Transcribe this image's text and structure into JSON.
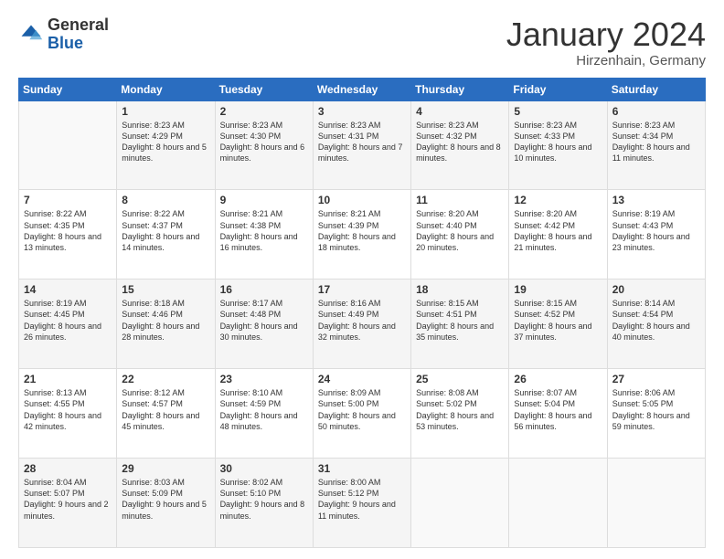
{
  "logo": {
    "general": "General",
    "blue": "Blue"
  },
  "title": "January 2024",
  "subtitle": "Hirzenhain, Germany",
  "days_of_week": [
    "Sunday",
    "Monday",
    "Tuesday",
    "Wednesday",
    "Thursday",
    "Friday",
    "Saturday"
  ],
  "weeks": [
    [
      {
        "day": "",
        "sunrise": "",
        "sunset": "",
        "daylight": ""
      },
      {
        "day": "1",
        "sunrise": "Sunrise: 8:23 AM",
        "sunset": "Sunset: 4:29 PM",
        "daylight": "Daylight: 8 hours and 5 minutes."
      },
      {
        "day": "2",
        "sunrise": "Sunrise: 8:23 AM",
        "sunset": "Sunset: 4:30 PM",
        "daylight": "Daylight: 8 hours and 6 minutes."
      },
      {
        "day": "3",
        "sunrise": "Sunrise: 8:23 AM",
        "sunset": "Sunset: 4:31 PM",
        "daylight": "Daylight: 8 hours and 7 minutes."
      },
      {
        "day": "4",
        "sunrise": "Sunrise: 8:23 AM",
        "sunset": "Sunset: 4:32 PM",
        "daylight": "Daylight: 8 hours and 8 minutes."
      },
      {
        "day": "5",
        "sunrise": "Sunrise: 8:23 AM",
        "sunset": "Sunset: 4:33 PM",
        "daylight": "Daylight: 8 hours and 10 minutes."
      },
      {
        "day": "6",
        "sunrise": "Sunrise: 8:23 AM",
        "sunset": "Sunset: 4:34 PM",
        "daylight": "Daylight: 8 hours and 11 minutes."
      }
    ],
    [
      {
        "day": "7",
        "sunrise": "Sunrise: 8:22 AM",
        "sunset": "Sunset: 4:35 PM",
        "daylight": "Daylight: 8 hours and 13 minutes."
      },
      {
        "day": "8",
        "sunrise": "Sunrise: 8:22 AM",
        "sunset": "Sunset: 4:37 PM",
        "daylight": "Daylight: 8 hours and 14 minutes."
      },
      {
        "day": "9",
        "sunrise": "Sunrise: 8:21 AM",
        "sunset": "Sunset: 4:38 PM",
        "daylight": "Daylight: 8 hours and 16 minutes."
      },
      {
        "day": "10",
        "sunrise": "Sunrise: 8:21 AM",
        "sunset": "Sunset: 4:39 PM",
        "daylight": "Daylight: 8 hours and 18 minutes."
      },
      {
        "day": "11",
        "sunrise": "Sunrise: 8:20 AM",
        "sunset": "Sunset: 4:40 PM",
        "daylight": "Daylight: 8 hours and 20 minutes."
      },
      {
        "day": "12",
        "sunrise": "Sunrise: 8:20 AM",
        "sunset": "Sunset: 4:42 PM",
        "daylight": "Daylight: 8 hours and 21 minutes."
      },
      {
        "day": "13",
        "sunrise": "Sunrise: 8:19 AM",
        "sunset": "Sunset: 4:43 PM",
        "daylight": "Daylight: 8 hours and 23 minutes."
      }
    ],
    [
      {
        "day": "14",
        "sunrise": "Sunrise: 8:19 AM",
        "sunset": "Sunset: 4:45 PM",
        "daylight": "Daylight: 8 hours and 26 minutes."
      },
      {
        "day": "15",
        "sunrise": "Sunrise: 8:18 AM",
        "sunset": "Sunset: 4:46 PM",
        "daylight": "Daylight: 8 hours and 28 minutes."
      },
      {
        "day": "16",
        "sunrise": "Sunrise: 8:17 AM",
        "sunset": "Sunset: 4:48 PM",
        "daylight": "Daylight: 8 hours and 30 minutes."
      },
      {
        "day": "17",
        "sunrise": "Sunrise: 8:16 AM",
        "sunset": "Sunset: 4:49 PM",
        "daylight": "Daylight: 8 hours and 32 minutes."
      },
      {
        "day": "18",
        "sunrise": "Sunrise: 8:15 AM",
        "sunset": "Sunset: 4:51 PM",
        "daylight": "Daylight: 8 hours and 35 minutes."
      },
      {
        "day": "19",
        "sunrise": "Sunrise: 8:15 AM",
        "sunset": "Sunset: 4:52 PM",
        "daylight": "Daylight: 8 hours and 37 minutes."
      },
      {
        "day": "20",
        "sunrise": "Sunrise: 8:14 AM",
        "sunset": "Sunset: 4:54 PM",
        "daylight": "Daylight: 8 hours and 40 minutes."
      }
    ],
    [
      {
        "day": "21",
        "sunrise": "Sunrise: 8:13 AM",
        "sunset": "Sunset: 4:55 PM",
        "daylight": "Daylight: 8 hours and 42 minutes."
      },
      {
        "day": "22",
        "sunrise": "Sunrise: 8:12 AM",
        "sunset": "Sunset: 4:57 PM",
        "daylight": "Daylight: 8 hours and 45 minutes."
      },
      {
        "day": "23",
        "sunrise": "Sunrise: 8:10 AM",
        "sunset": "Sunset: 4:59 PM",
        "daylight": "Daylight: 8 hours and 48 minutes."
      },
      {
        "day": "24",
        "sunrise": "Sunrise: 8:09 AM",
        "sunset": "Sunset: 5:00 PM",
        "daylight": "Daylight: 8 hours and 50 minutes."
      },
      {
        "day": "25",
        "sunrise": "Sunrise: 8:08 AM",
        "sunset": "Sunset: 5:02 PM",
        "daylight": "Daylight: 8 hours and 53 minutes."
      },
      {
        "day": "26",
        "sunrise": "Sunrise: 8:07 AM",
        "sunset": "Sunset: 5:04 PM",
        "daylight": "Daylight: 8 hours and 56 minutes."
      },
      {
        "day": "27",
        "sunrise": "Sunrise: 8:06 AM",
        "sunset": "Sunset: 5:05 PM",
        "daylight": "Daylight: 8 hours and 59 minutes."
      }
    ],
    [
      {
        "day": "28",
        "sunrise": "Sunrise: 8:04 AM",
        "sunset": "Sunset: 5:07 PM",
        "daylight": "Daylight: 9 hours and 2 minutes."
      },
      {
        "day": "29",
        "sunrise": "Sunrise: 8:03 AM",
        "sunset": "Sunset: 5:09 PM",
        "daylight": "Daylight: 9 hours and 5 minutes."
      },
      {
        "day": "30",
        "sunrise": "Sunrise: 8:02 AM",
        "sunset": "Sunset: 5:10 PM",
        "daylight": "Daylight: 9 hours and 8 minutes."
      },
      {
        "day": "31",
        "sunrise": "Sunrise: 8:00 AM",
        "sunset": "Sunset: 5:12 PM",
        "daylight": "Daylight: 9 hours and 11 minutes."
      },
      {
        "day": "",
        "sunrise": "",
        "sunset": "",
        "daylight": ""
      },
      {
        "day": "",
        "sunrise": "",
        "sunset": "",
        "daylight": ""
      },
      {
        "day": "",
        "sunrise": "",
        "sunset": "",
        "daylight": ""
      }
    ]
  ]
}
